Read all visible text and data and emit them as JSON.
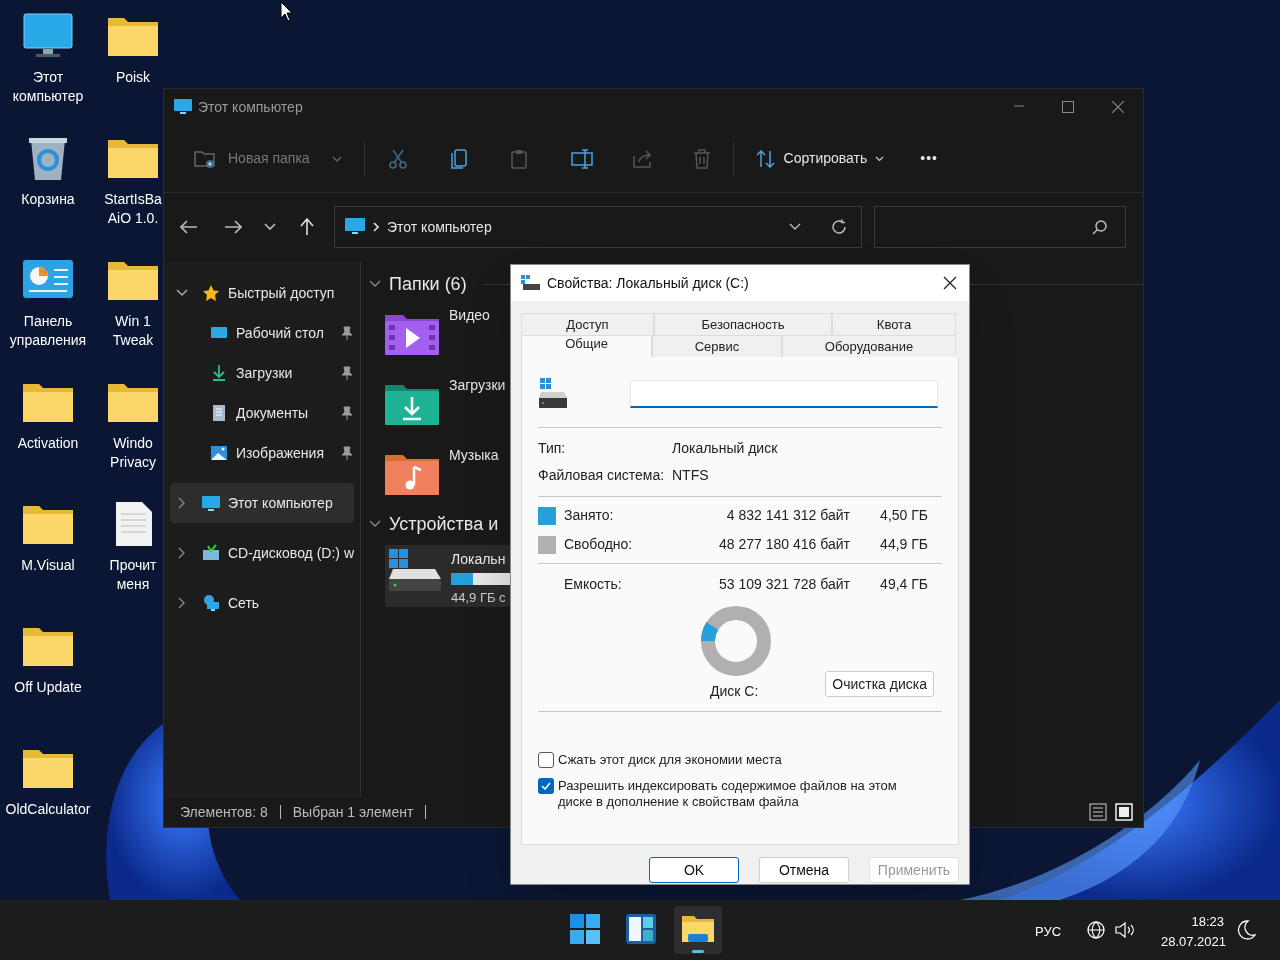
{
  "desktop": {
    "columns": [
      [
        {
          "label": "Этот компьютер",
          "kind": "monitor"
        },
        {
          "label": "Корзина",
          "kind": "recycle"
        },
        {
          "label": "Панель управления",
          "kind": "control"
        },
        {
          "label": "Activation",
          "kind": "folder"
        },
        {
          "label": "M.Visual",
          "kind": "folder"
        },
        {
          "label": "Off Update",
          "kind": "folder"
        },
        {
          "label": "OldCalculator",
          "kind": "folder"
        }
      ],
      [
        {
          "label": "Poisk",
          "kind": "folder"
        },
        {
          "label": "StartIsBa AiO 1.0.",
          "kind": "folder"
        },
        {
          "label": "Win 1 Tweak",
          "kind": "folder"
        },
        {
          "label": "Windo Privacy",
          "kind": "folder"
        },
        {
          "label": "Прочит меня",
          "kind": "document"
        }
      ]
    ]
  },
  "explorer": {
    "title": "Этот компьютер",
    "toolbar": {
      "new_folder": "Новая папка",
      "sort": "Сортировать",
      "more": "•••"
    },
    "address": "Этот компьютер",
    "nav": [
      {
        "label": "Быстрый доступ",
        "kind": "star",
        "expanded": true,
        "selected": false,
        "children": [
          {
            "label": "Рабочий стол",
            "kind": "desktop",
            "pinned": true,
            "selected": false
          },
          {
            "label": "Загрузки",
            "kind": "download",
            "pinned": true,
            "selected": false
          },
          {
            "label": "Документы",
            "kind": "docs",
            "pinned": true,
            "selected": false
          },
          {
            "label": "Изображения",
            "kind": "pictures",
            "pinned": true,
            "selected": false
          }
        ]
      },
      {
        "label": "Этот компьютер",
        "kind": "pc",
        "expanded": false,
        "selected": true
      },
      {
        "label": "CD-дисковод (D:) w",
        "kind": "cd",
        "expanded": false,
        "selected": false
      },
      {
        "label": "Сеть",
        "kind": "network",
        "expanded": false,
        "selected": false
      }
    ],
    "sections": [
      {
        "title": "Папки (6)",
        "expanded": true,
        "items": [
          {
            "label": "Видео",
            "kind": "video"
          },
          {
            "label": "Загрузки",
            "kind": "download"
          },
          {
            "label": "Музыка",
            "kind": "music"
          }
        ]
      },
      {
        "title": "Устройства и",
        "expanded": true,
        "drives": [
          {
            "label": "Локальн",
            "level": 0.37,
            "info": "44,9 ГБ с",
            "selected": true
          }
        ]
      }
    ],
    "status_bar": [
      "Элементов: 8",
      "Выбран 1 элемент"
    ]
  },
  "dialog": {
    "title": "Свойства: Локальный диск (C:)",
    "tabs": [
      [
        {
          "label": "Доступ",
          "selected": false
        },
        {
          "label": "Безопасность",
          "selected": false
        },
        {
          "label": "Квота",
          "selected": false
        }
      ],
      [
        {
          "label": "Общие",
          "selected": true
        },
        {
          "label": "Сервис",
          "selected": false
        },
        {
          "label": "Оборудование",
          "selected": false
        }
      ]
    ],
    "props": [
      {
        "label": "Тип:",
        "value": "Локальный диск"
      },
      {
        "label": "Файловая система:",
        "value": "NTFS"
      }
    ],
    "usage": [
      {
        "label": "Занято:",
        "bytes": "4 832 141 312 байт",
        "size": "4,50 ГБ",
        "color": "#26a0da"
      },
      {
        "label": "Свободно:",
        "bytes": "48 277 180 416 байт",
        "size": "44,9 ГБ",
        "color": "#b0b0b0"
      }
    ],
    "capacity": {
      "label": "Емкость:",
      "bytes": "53 109 321 728 байт",
      "size": "49,4 ГБ"
    },
    "donut": {
      "level": 0.09
    },
    "disk_label": "Диск C:",
    "cleanup": "Очистка диска",
    "options": [
      {
        "label": "Сжать этот диск для экономии места",
        "checked": false
      },
      {
        "label": "Разрешить индексировать содержимое файлов на этом диске в дополнение к свойствам файла",
        "checked": true
      }
    ],
    "buttons": [
      {
        "label": "OK",
        "default": true,
        "disabled": false
      },
      {
        "label": "Отмена",
        "default": false,
        "disabled": false
      },
      {
        "label": "Применить",
        "default": false,
        "disabled": true
      }
    ]
  },
  "taskbar": {
    "apps": [
      {
        "kind": "start",
        "active": false
      },
      {
        "kind": "widgets",
        "active": false
      },
      {
        "kind": "explorer",
        "active": true
      }
    ],
    "language": "РУС",
    "time": "18:23",
    "date": "28.07.2021"
  }
}
